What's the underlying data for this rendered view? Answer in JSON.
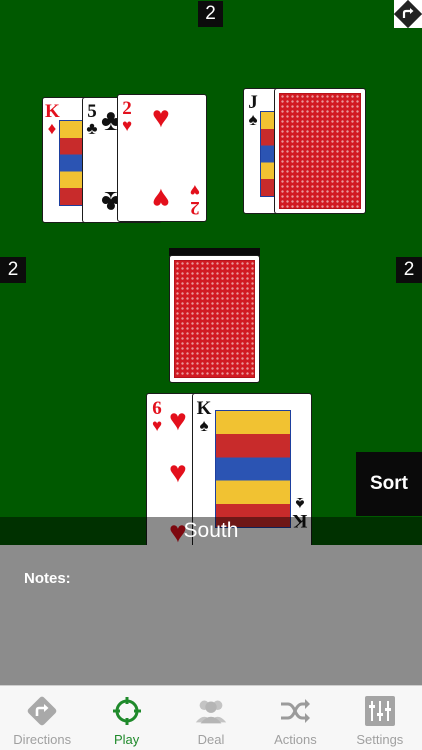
{
  "counts": {
    "north": "2",
    "west": "2",
    "east": "2"
  },
  "cards": {
    "north_hand": [
      {
        "rank": "K",
        "suit": "♦",
        "color": "red"
      },
      {
        "rank": "5",
        "suit": "♣",
        "color": "black"
      },
      {
        "rank": "2",
        "suit": "♥",
        "color": "red"
      }
    ],
    "east_hand": [
      {
        "rank": "J",
        "suit": "♠",
        "color": "black"
      }
    ],
    "south_hand": [
      {
        "rank": "6",
        "suit": "♥",
        "color": "red"
      },
      {
        "rank": "K",
        "suit": "♠",
        "color": "black"
      }
    ]
  },
  "player": {
    "name": "South"
  },
  "sort_button": {
    "label": "Sort"
  },
  "notes": {
    "label": "Notes:"
  },
  "tabs": [
    {
      "label": "Directions",
      "icon": "directions-icon",
      "active": false
    },
    {
      "label": "Play",
      "icon": "target-icon",
      "active": true
    },
    {
      "label": "Deal",
      "icon": "users-icon",
      "active": false
    },
    {
      "label": "Actions",
      "icon": "shuffle-icon",
      "active": false
    },
    {
      "label": "Settings",
      "icon": "sliders-icon",
      "active": false
    }
  ],
  "colors": {
    "table": "#005900",
    "card_back": "#d11a22",
    "active_tab": "#1f8a2b",
    "inactive_tab": "#a0a0a0"
  }
}
